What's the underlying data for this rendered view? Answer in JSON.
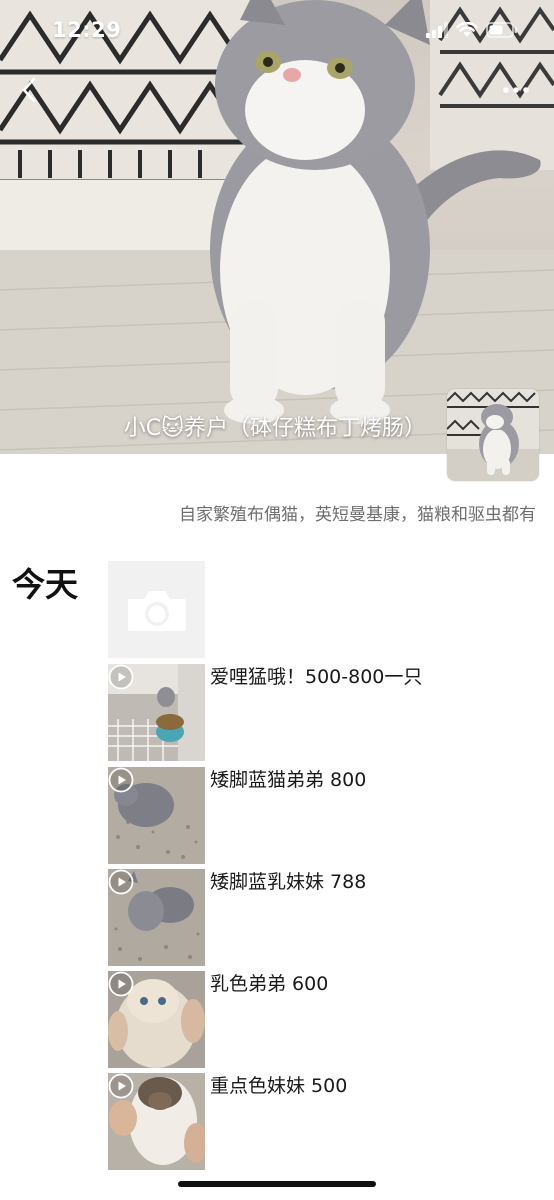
{
  "status_bar": {
    "time": "12:29",
    "icons": [
      "cellular-signal-icon",
      "wifi-icon",
      "battery-icon"
    ]
  },
  "nav": {
    "back_icon": "chevron-left-icon",
    "more_icon": "ellipsis-icon"
  },
  "profile": {
    "name": "小C🐱养户（砵仔糕布丁烤肠）",
    "signature": "自家繁殖布偶猫，英短曼基康，猫粮和驱虫都有"
  },
  "feed": {
    "day_label": "今天",
    "camera_icon": "camera-icon",
    "posts": [
      {
        "text": "爱哩猛哦！500-800一只",
        "is_video": true
      },
      {
        "text": "矮脚蓝猫弟弟 800",
        "is_video": true
      },
      {
        "text": "矮脚蓝乳妹妹 788",
        "is_video": true
      },
      {
        "text": "乳色弟弟 600",
        "is_video": true
      },
      {
        "text": "重点色妹妹 500",
        "is_video": true
      }
    ]
  },
  "colors": {
    "background": "#ffffff",
    "signature_text": "#6e6e6e",
    "camera_tile": "#f1f1f1"
  }
}
